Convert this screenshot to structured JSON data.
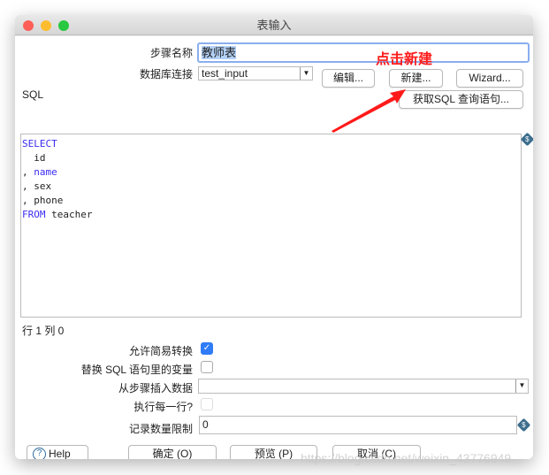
{
  "window": {
    "title": "表输入"
  },
  "form": {
    "step_name_label": "步骤名称",
    "step_name_value": "教师表",
    "db_conn_label": "数据库连接",
    "db_conn_value": "test_input",
    "edit_button": "编辑...",
    "new_button": "新建...",
    "wizard_button": "Wizard...",
    "get_sql_button": "获取SQL 查询语句...",
    "sql_label": "SQL",
    "sql_lines": [
      {
        "kw": "SELECT",
        "rest": ""
      },
      {
        "kw": "",
        "rest": "  id"
      },
      {
        "kw": "",
        "prefix": ", ",
        "name": "name"
      },
      {
        "kw": "",
        "rest": ", sex"
      },
      {
        "kw": "",
        "rest": ", phone"
      },
      {
        "kw": "FROM",
        "rest": " teacher"
      }
    ],
    "cursor_pos": "行 1 列 0",
    "lazy_conv_label": "允许简易转换",
    "lazy_conv_checked": true,
    "replace_vars_label": "替换 SQL 语句里的变量",
    "replace_vars_checked": false,
    "insert_from_step_label": "从步骤插入数据",
    "insert_from_step_value": "",
    "exec_each_row_label": "执行每一行?",
    "exec_each_row_checked": false,
    "limit_label": "记录数量限制",
    "limit_value": "0"
  },
  "buttons": {
    "help": "Help",
    "ok": "确定 (O)",
    "preview": "预览 (P)",
    "cancel": "取消 (C)"
  },
  "annotation": {
    "text": "点击新建",
    "color": "#ff1a1a"
  },
  "watermark": "https://blog.csdn.net/weixin_43776949"
}
